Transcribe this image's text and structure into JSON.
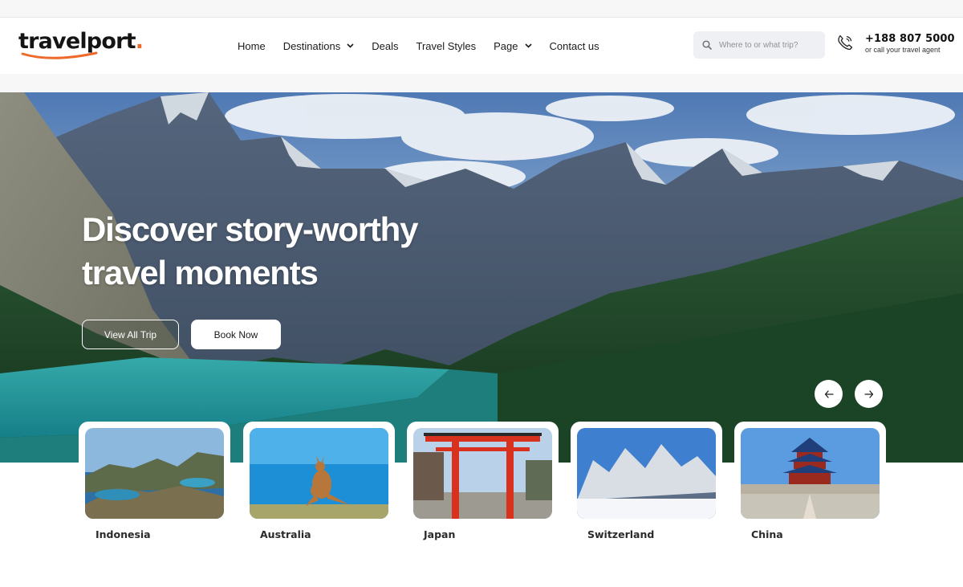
{
  "brand": {
    "name": "travelport",
    "dot": ".",
    "accent": "#ef6a2a"
  },
  "nav": {
    "items": [
      {
        "label": "Home",
        "dropdown": false
      },
      {
        "label": "Destinations",
        "dropdown": true
      },
      {
        "label": "Deals",
        "dropdown": false
      },
      {
        "label": "Travel Styles",
        "dropdown": false
      },
      {
        "label": "Page",
        "dropdown": true
      },
      {
        "label": "Contact us",
        "dropdown": false
      }
    ]
  },
  "search": {
    "placeholder": "Where to or what trip?",
    "value": ""
  },
  "contact": {
    "phone": "+188 807 5000",
    "subtext": "or call your travel agent"
  },
  "hero": {
    "title_line1": "Discover story-worthy",
    "title_line2": "travel moments",
    "primary_button": "View All Trip",
    "secondary_button": "Book Now",
    "prev_icon": "arrow-left-icon",
    "next_icon": "arrow-right-icon"
  },
  "destinations": [
    {
      "name": "Indonesia"
    },
    {
      "name": "Australia"
    },
    {
      "name": "Japan"
    },
    {
      "name": "Switzerland"
    },
    {
      "name": "China"
    }
  ]
}
